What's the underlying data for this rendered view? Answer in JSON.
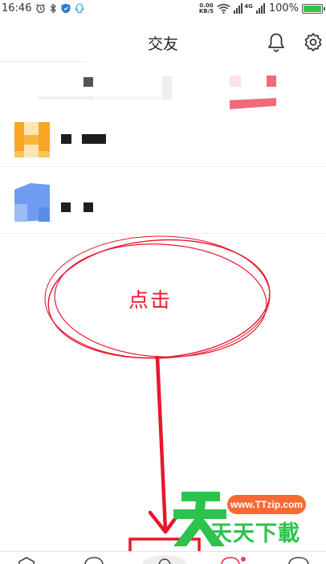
{
  "status_bar": {
    "time": "16:46",
    "net_speed_value": "0.00",
    "net_speed_unit": "KB/S",
    "signal_label": "4G",
    "battery": "100%",
    "battery_level": 1.0
  },
  "header": {
    "title": "交友",
    "icons": [
      "bell-icon",
      "gear-icon"
    ]
  },
  "annotation": {
    "label": "点击",
    "color": "#e8172e"
  },
  "watermark": {
    "url": "www.TTzip.com",
    "text": "天天下載"
  },
  "bottom_nav": {
    "icons": [
      "nav-home-icon",
      "nav-search-icon",
      "nav-friends-icon",
      "nav-message-icon",
      "nav-profile-icon"
    ]
  },
  "colors": {
    "accent_red": "#e8172e",
    "watermark_green": "#2dc24e",
    "watermark_orange": "#f86a32"
  }
}
